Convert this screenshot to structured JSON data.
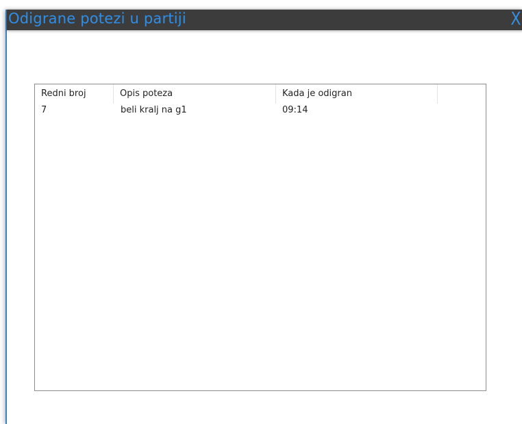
{
  "window": {
    "title": "Odigrane potezi u partiji",
    "close_glyph": "X"
  },
  "table": {
    "columns": [
      "Redni broj",
      "Opis poteza",
      "Kada je odigran"
    ],
    "rows": [
      [
        "7",
        "beli kralj na g1",
        "09:14"
      ]
    ]
  },
  "colors": {
    "titlebar": "#3c3c3c",
    "title_text": "#2f8fe8",
    "border": "#8c8c8c"
  }
}
